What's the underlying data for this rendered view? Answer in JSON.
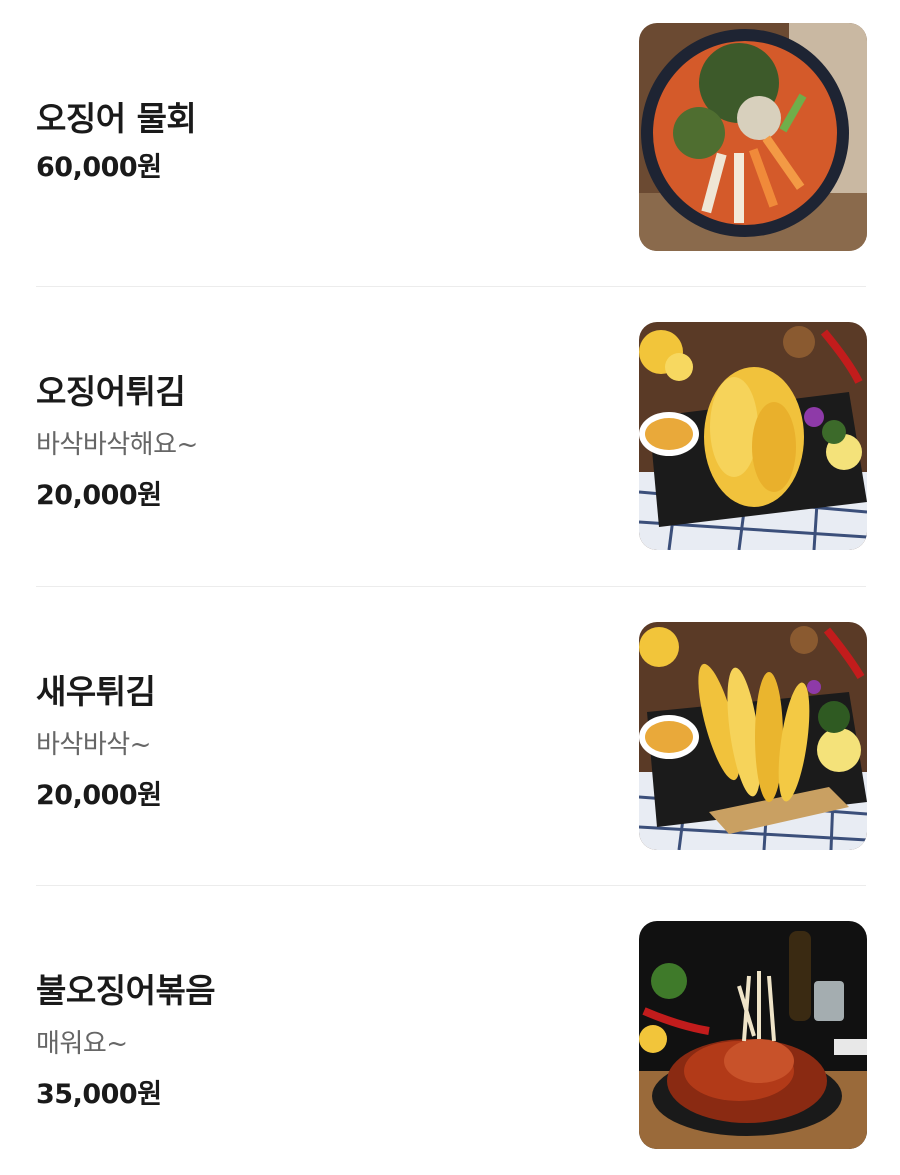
{
  "menu": {
    "items": [
      {
        "name": "오징어 물회",
        "description": "",
        "price": "60,000원",
        "image": "cold-raw-squid-soup-photo"
      },
      {
        "name": "오징어튀김",
        "description": "바삭바삭해요~",
        "price": "20,000원",
        "image": "fried-squid-photo"
      },
      {
        "name": "새우튀김",
        "description": "바삭바삭~",
        "price": "20,000원",
        "image": "fried-shrimp-photo"
      },
      {
        "name": "불오징어볶음",
        "description": "매워요~",
        "price": "35,000원",
        "image": "spicy-stir-fried-squid-photo"
      }
    ]
  }
}
